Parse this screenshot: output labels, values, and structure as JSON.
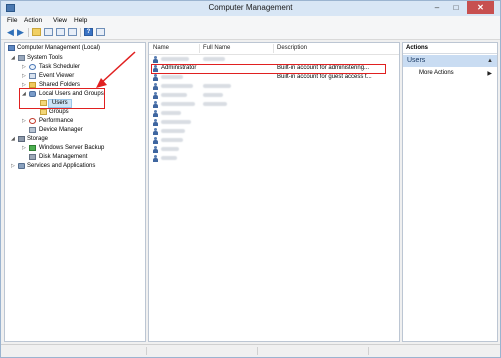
{
  "window": {
    "title": "Computer Management",
    "minimize": "–",
    "maximize": "□",
    "close": "✕"
  },
  "menu": [
    "File",
    "Action",
    "View",
    "Help"
  ],
  "toolbar": [
    "back-arrow-icon",
    "forward-arrow-icon",
    "up-folder-icon",
    "show-hide-tree-icon",
    "refresh-icon",
    "export-list-icon",
    "help-icon",
    "properties-icon"
  ],
  "tree": {
    "root": "Computer Management (Local)",
    "system_tools": "System Tools",
    "task_scheduler": "Task Scheduler",
    "event_viewer": "Event Viewer",
    "shared_folders": "Shared Folders",
    "local_users_groups": "Local Users and Groups",
    "users": "Users",
    "groups": "Groups",
    "performance": "Performance",
    "device_manager": "Device Manager",
    "storage": "Storage",
    "windows_server_backup": "Windows Server Backup",
    "disk_management": "Disk Management",
    "services_apps": "Services and Applications"
  },
  "list": {
    "columns": {
      "name": "Name",
      "full_name": "Full Name",
      "description": "Description"
    },
    "rows": [
      {
        "name": "",
        "full_name": "",
        "description": ""
      },
      {
        "name": "Administrator",
        "full_name": "",
        "description": "Built-in account for administering..."
      },
      {
        "name": "",
        "full_name": "",
        "description": "Built-in account for guest access t..."
      },
      {
        "name": "",
        "full_name": "",
        "description": ""
      },
      {
        "name": "",
        "full_name": "",
        "description": ""
      },
      {
        "name": "",
        "full_name": "",
        "description": ""
      },
      {
        "name": "",
        "full_name": "",
        "description": ""
      },
      {
        "name": "",
        "full_name": "",
        "description": ""
      },
      {
        "name": "",
        "full_name": "",
        "description": ""
      },
      {
        "name": "",
        "full_name": "",
        "description": ""
      },
      {
        "name": "",
        "full_name": "",
        "description": ""
      },
      {
        "name": "",
        "full_name": "",
        "description": ""
      }
    ]
  },
  "actions": {
    "header": "Actions",
    "section": "Users",
    "more_actions": "More Actions"
  },
  "colors": {
    "annotation": "#e02020",
    "selection": "#cde4f7",
    "section_bg": "#c9dcf2"
  }
}
